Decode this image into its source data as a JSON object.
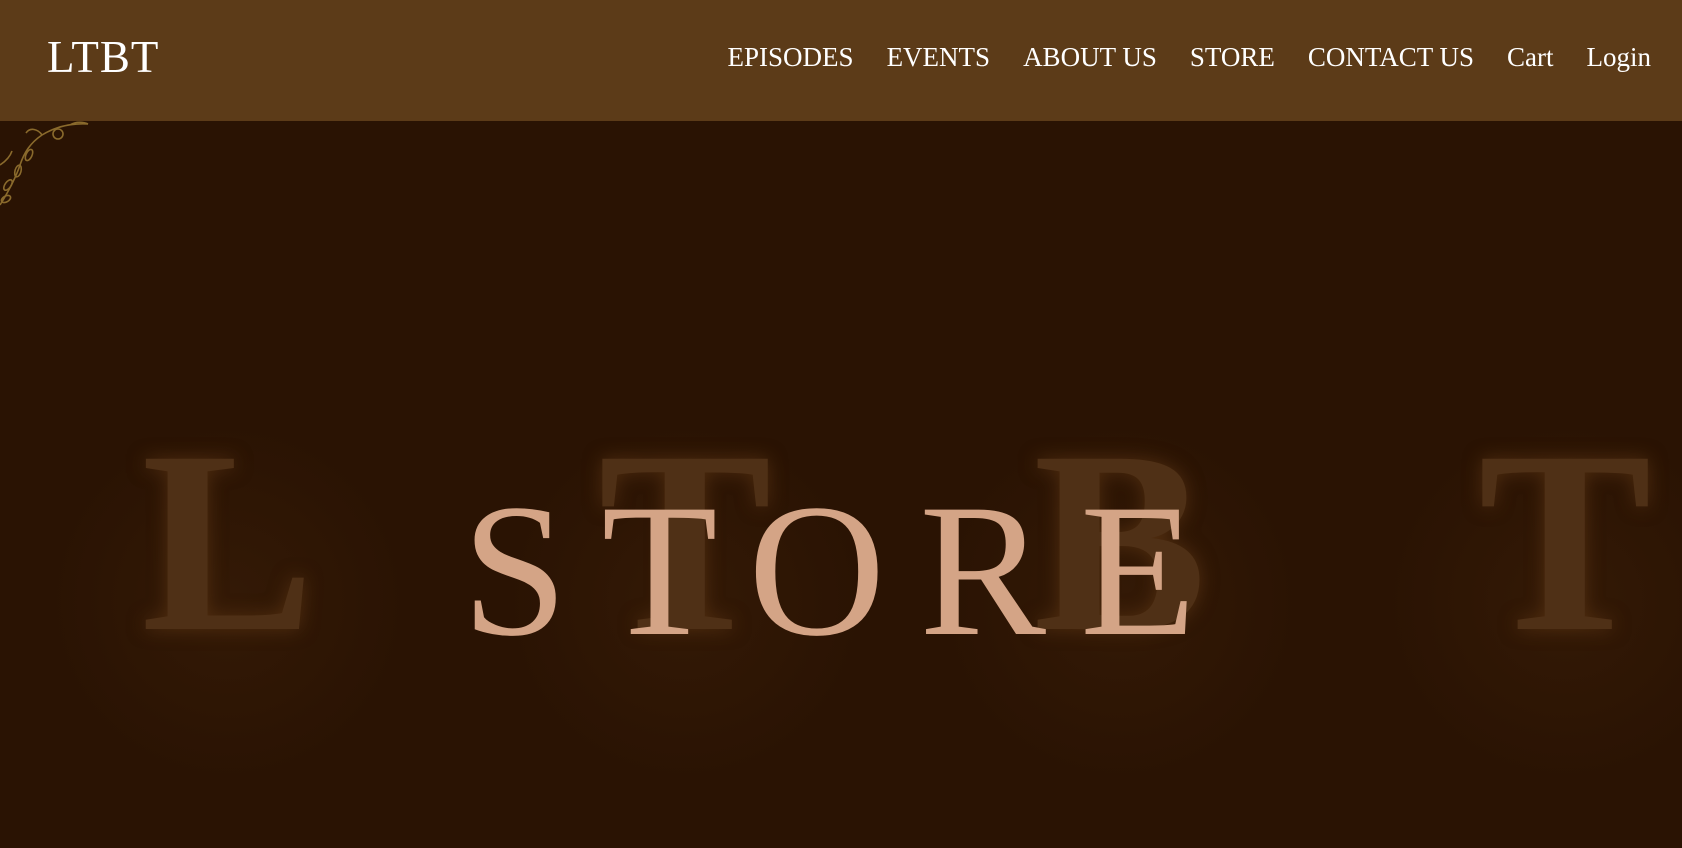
{
  "header": {
    "logo": "LTBT",
    "nav": [
      {
        "label": "EPISODES"
      },
      {
        "label": "EVENTS"
      },
      {
        "label": "ABOUT US"
      },
      {
        "label": "STORE"
      },
      {
        "label": "CONTACT US"
      },
      {
        "label": "Cart"
      },
      {
        "label": "Login"
      }
    ]
  },
  "hero": {
    "title": "STORE",
    "background_letters": [
      "L",
      "T",
      "B",
      "T"
    ]
  },
  "colors": {
    "header_bg": "#5c3b18",
    "hero_bg": "#2a1303",
    "title": "#d4a486",
    "nav_text": "#ffffff"
  },
  "icons": {
    "ornament": "vine-ornament-icon"
  }
}
